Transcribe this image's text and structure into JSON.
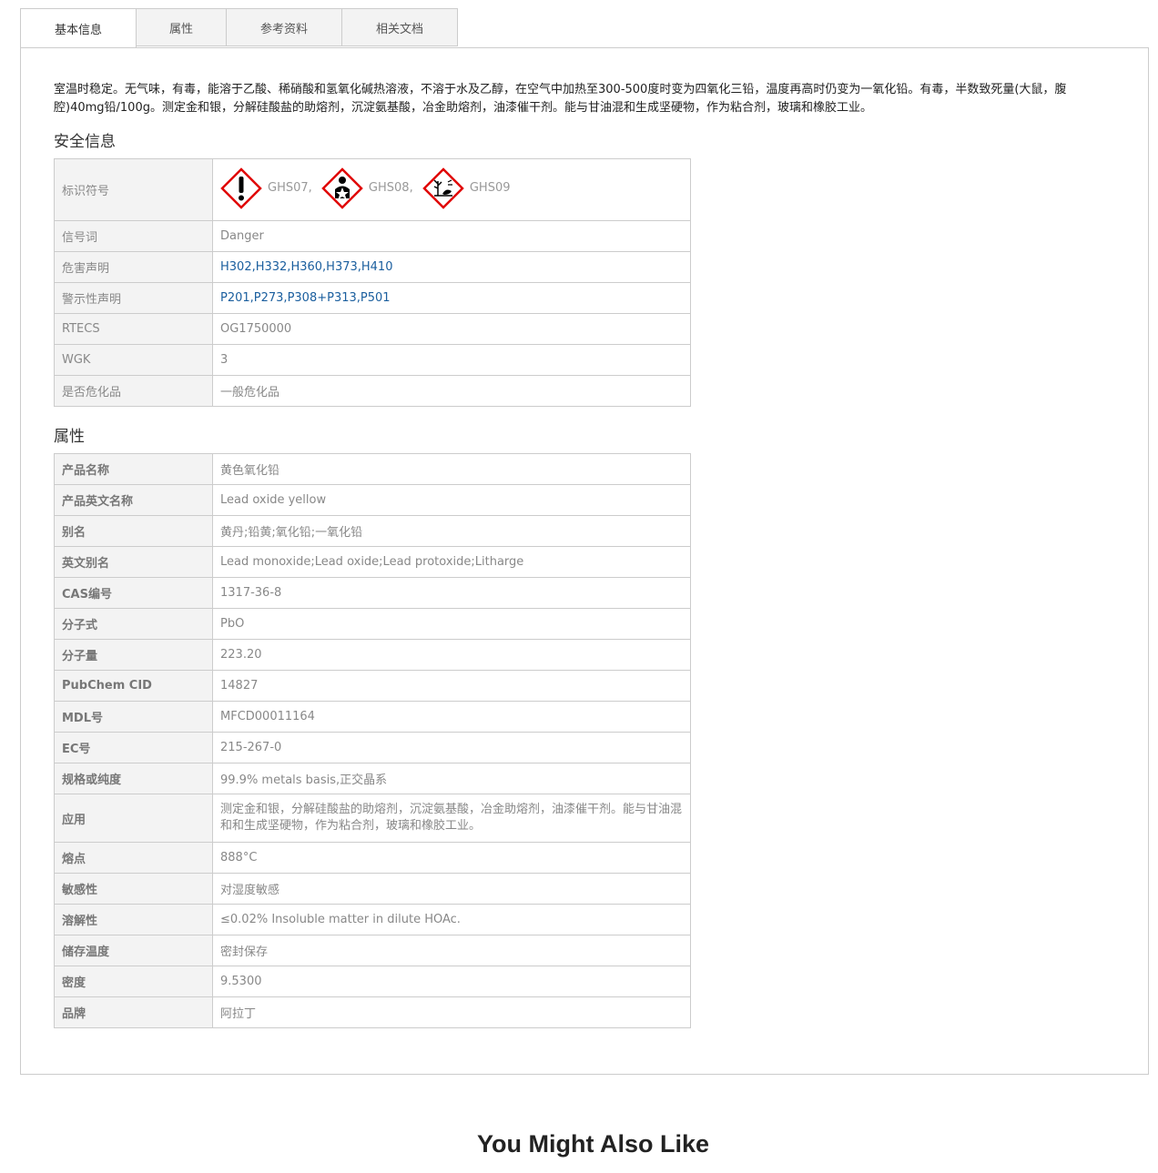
{
  "tabs": [
    "基本信息",
    "属性",
    "参考资料",
    "相关文档"
  ],
  "description": "室温时稳定。无气味，有毒，能溶于乙酸、稀硝酸和氢氧化碱热溶液，不溶于水及乙醇，在空气中加热至300-500度时变为四氧化三铅，温度再高时仍变为一氧化铅。有毒，半数致死量(大鼠，腹腔)40mg铅/100g。测定金和银，分解硅酸盐的助熔剂，沉淀氨基酸，冶金助熔剂，油漆催干剂。能与甘油混和生成坚硬物，作为粘合剂，玻璃和橡胶工业。",
  "safety": {
    "title": "安全信息",
    "symbol_label": "标识符号",
    "ghs": [
      {
        "label": "GHS07,",
        "icon": "exclamation-icon"
      },
      {
        "label": "GHS08,",
        "icon": "health-hazard-icon"
      },
      {
        "label": "GHS09",
        "icon": "environment-icon"
      }
    ],
    "rows": [
      {
        "k": "信号词",
        "v": "Danger"
      },
      {
        "k": "危害声明",
        "v": "H302,H332,H360,H373,H410",
        "link": true
      },
      {
        "k": "警示性声明",
        "v": "P201,P273,P308+P313,P501",
        "link": true
      },
      {
        "k": "RTECS",
        "v": "OG1750000"
      },
      {
        "k": "WGK",
        "v": "3"
      },
      {
        "k": "是否危化品",
        "v": "一般危化品"
      }
    ]
  },
  "properties": {
    "title": "属性",
    "rows": [
      {
        "k": "产品名称",
        "v": "黄色氧化铅"
      },
      {
        "k": "产品英文名称",
        "v": "Lead oxide yellow"
      },
      {
        "k": "别名",
        "v": "黄丹;铅黄;氧化铅;一氧化铅"
      },
      {
        "k": "英文别名",
        "v": "Lead monoxide;Lead oxide;Lead protoxide;Litharge"
      },
      {
        "k": "CAS编号",
        "v": "1317-36-8"
      },
      {
        "k": "分子式",
        "v": "PbO"
      },
      {
        "k": "分子量",
        "v": "223.20"
      },
      {
        "k": "PubChem CID",
        "v": "14827"
      },
      {
        "k": "MDL号",
        "v": "MFCD00011164"
      },
      {
        "k": "EC号",
        "v": "215-267-0"
      },
      {
        "k": "规格或纯度",
        "v": "99.9% metals basis,正交晶系"
      },
      {
        "k": "应用",
        "v": "测定金和银，分解硅酸盐的助熔剂，沉淀氨基酸，冶金助熔剂，油漆催干剂。能与甘油混和和生成坚硬物，作为粘合剂，玻璃和橡胶工业。",
        "tall": true
      },
      {
        "k": "熔点",
        "v": "888°C"
      },
      {
        "k": "敏感性",
        "v": "对湿度敏感"
      },
      {
        "k": "溶解性",
        "v": "≤0.02% Insoluble matter in dilute HOAc."
      },
      {
        "k": "储存温度",
        "v": "密封保存"
      },
      {
        "k": "密度",
        "v": "9.5300"
      },
      {
        "k": "品牌",
        "v": "阿拉丁"
      }
    ]
  },
  "more_title": "You Might Also Like",
  "colors": {
    "link": "#1a5e9e",
    "ghs_red": "#e00000"
  }
}
